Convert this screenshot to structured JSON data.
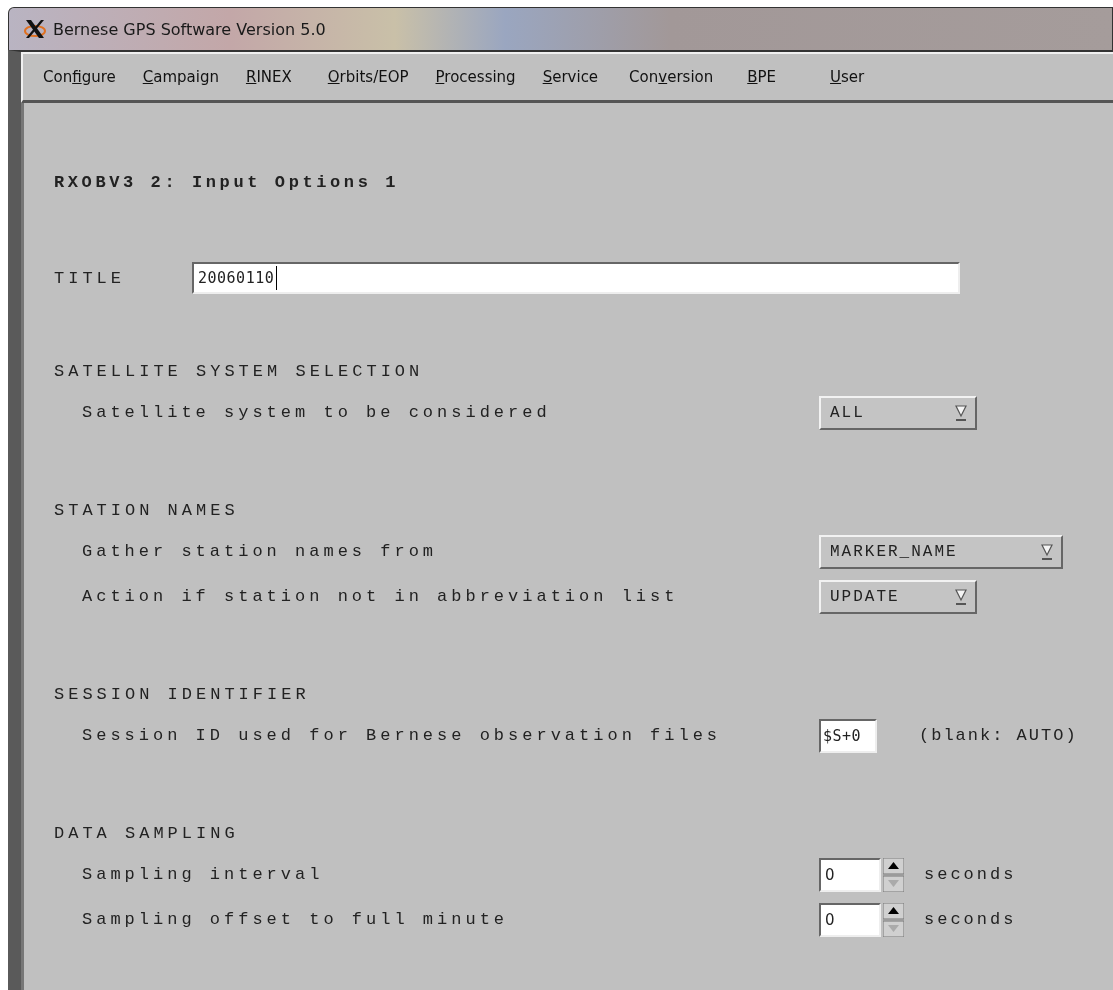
{
  "window": {
    "title": "Bernese GPS Software Version 5.0"
  },
  "menu": [
    {
      "pre": "Con",
      "key": "f",
      "post": "igure"
    },
    {
      "key": "C",
      "post": "ampaign"
    },
    {
      "key": "R",
      "post": "INEX"
    },
    {
      "key": "O",
      "post": "rbits/EOP"
    },
    {
      "key": "P",
      "post": "rocessing"
    },
    {
      "key": "S",
      "post": "ervice"
    },
    {
      "pre": "Con",
      "key": "v",
      "post": "ersion"
    },
    {
      "key": "B",
      "post": "PE"
    },
    {
      "key": "U",
      "post": "ser"
    }
  ],
  "form": {
    "heading": "RXOBV3 2: Input Options 1",
    "title_label": "TITLE",
    "title_value": "20060110",
    "sections": [
      {
        "heading": "SATELLITE SYSTEM SELECTION",
        "rows": [
          {
            "kind": "dropdown",
            "label": "Satellite system to be considered",
            "value": "ALL"
          }
        ]
      },
      {
        "heading": "STATION NAMES",
        "rows": [
          {
            "kind": "dropdown",
            "label": "Gather station names from",
            "value": "MARKER_NAME"
          },
          {
            "kind": "dropdown",
            "label": "Action if station not in abbreviation list",
            "value": "UPDATE"
          }
        ]
      },
      {
        "heading": "SESSION IDENTIFIER",
        "rows": [
          {
            "kind": "text",
            "label": "Session ID used for Bernese observation files",
            "value": "$S+0",
            "note": "(blank: AUTO)"
          }
        ]
      },
      {
        "heading": "DATA SAMPLING",
        "rows": [
          {
            "kind": "spinner",
            "label": "Sampling interval",
            "value": "0",
            "note": "seconds"
          },
          {
            "kind": "spinner",
            "label": "Sampling offset to full minute",
            "value": "0",
            "note": "seconds"
          }
        ]
      }
    ]
  }
}
